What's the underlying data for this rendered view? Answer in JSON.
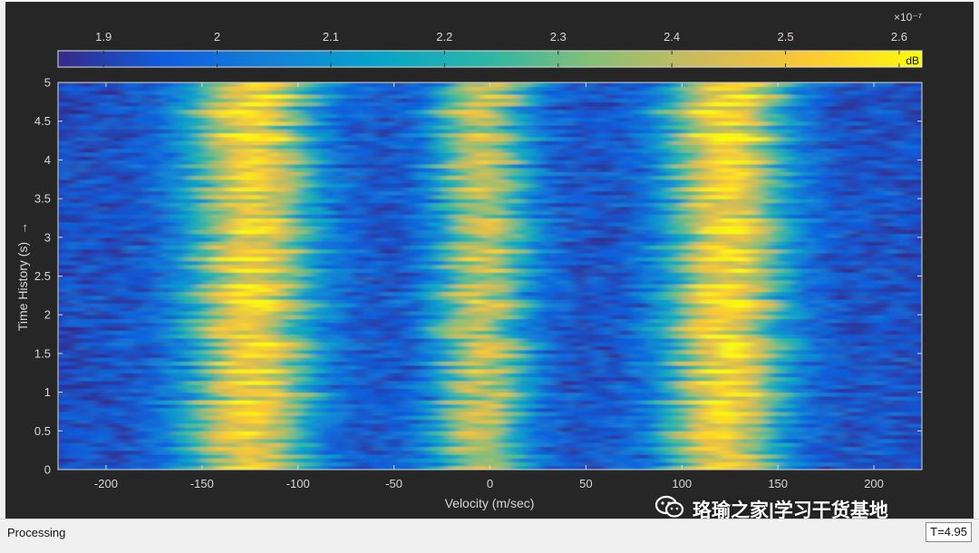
{
  "chart_data": {
    "type": "heatmap",
    "title": "",
    "xlabel": "Velocity (m/sec)",
    "ylabel": "Time History (s)",
    "ylabel_arrow": "→",
    "xlim": [
      -225,
      225
    ],
    "ylim": [
      0,
      5
    ],
    "x_ticks": [
      -200,
      -150,
      -100,
      -50,
      0,
      50,
      100,
      150,
      200
    ],
    "x_tick_labels": [
      "-200",
      "-150",
      "-100",
      "-50",
      "0",
      "50",
      "100",
      "150",
      "200"
    ],
    "y_ticks": [
      0,
      0.5,
      1,
      1.5,
      2,
      2.5,
      3,
      3.5,
      4,
      4.5,
      5
    ],
    "y_tick_labels": [
      "0",
      "0.5",
      "1",
      "1.5",
      "2",
      "2.5",
      "3",
      "3.5",
      "4",
      "4.5",
      "5"
    ],
    "colorbar": {
      "orientation": "horizontal",
      "position": "top",
      "range": [
        1.86,
        2.62
      ],
      "ticks": [
        1.9,
        2.0,
        2.1,
        2.2,
        2.3,
        2.4,
        2.5,
        2.6
      ],
      "tick_labels": [
        "1.9",
        "2",
        "2.1",
        "2.2",
        "2.3",
        "2.4",
        "2.5",
        "2.6"
      ],
      "exponent_label": "×10⁻⁷",
      "unit_label": "dB",
      "colormap": "parula"
    },
    "peaks": [
      {
        "velocity": -125,
        "approx_value": 2.58
      },
      {
        "velocity": -5,
        "approx_value": 2.48
      },
      {
        "velocity": 122,
        "approx_value": 2.6
      }
    ],
    "grid": false
  },
  "status": {
    "text": "Processing",
    "time_readout": "T=4.95"
  },
  "watermark": {
    "text": "珞瑜之家|学习干货基地",
    "icon": "wechat-icon"
  },
  "colors": {
    "figure_background": "#262626",
    "axes_text": "#d8d8d8",
    "status_bar": "#f0f0f0"
  }
}
